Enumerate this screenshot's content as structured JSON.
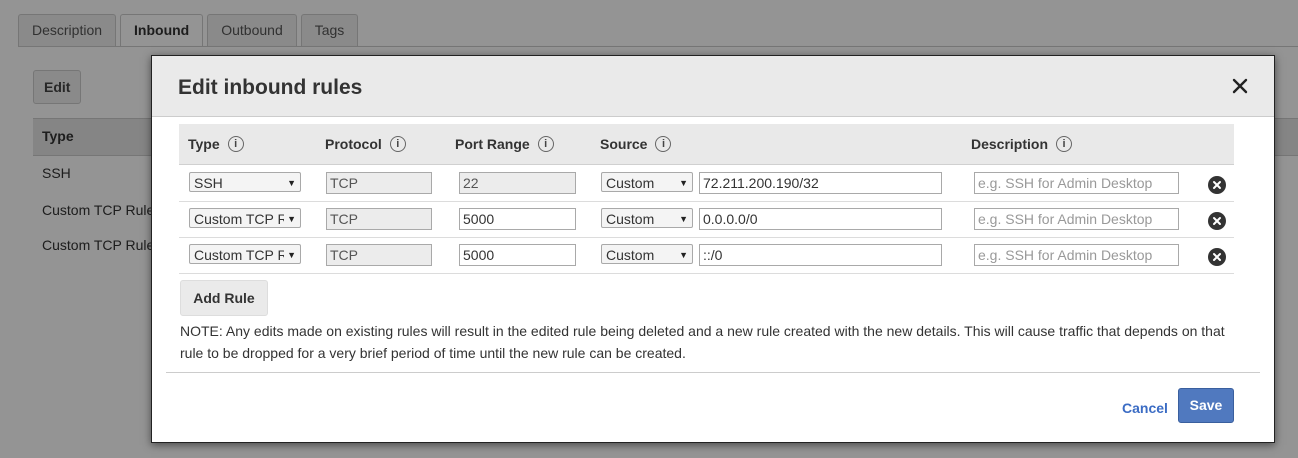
{
  "page_tabs": [
    {
      "label": "Description"
    },
    {
      "label": "Inbound"
    },
    {
      "label": "Outbound"
    },
    {
      "label": "Tags"
    }
  ],
  "bg": {
    "edit_label": "Edit",
    "type_header": "Type",
    "rows": [
      "SSH",
      "Custom TCP Rule",
      "Custom TCP Rule"
    ]
  },
  "modal": {
    "title": "Edit inbound rules",
    "columns": {
      "type": "Type",
      "protocol": "Protocol",
      "port_range": "Port Range",
      "source": "Source",
      "description": "Description"
    },
    "rules": [
      {
        "type": "SSH",
        "protocol": "TCP",
        "port": "22",
        "source_type": "Custom",
        "source": "72.211.200.190/32",
        "description_placeholder": "e.g. SSH for Admin Desktop"
      },
      {
        "type": "Custom TCP R",
        "protocol": "TCP",
        "port": "5000",
        "source_type": "Custom",
        "source": "0.0.0.0/0",
        "description_placeholder": "e.g. SSH for Admin Desktop"
      },
      {
        "type": "Custom TCP R",
        "protocol": "TCP",
        "port": "5000",
        "source_type": "Custom",
        "source": "::/0",
        "description_placeholder": "e.g. SSH for Admin Desktop"
      }
    ],
    "add_rule_label": "Add Rule",
    "note": "NOTE: Any edits made on existing rules will result in the edited rule being deleted and a new rule created with the new details. This will cause traffic that depends on that rule to be dropped for a very brief period of time until the new rule can be created.",
    "cancel_label": "Cancel",
    "save_label": "Save"
  },
  "icons": {
    "info": "info-circle-icon",
    "close": "close-icon",
    "delete": "remove-circle-icon",
    "dropdown": "caret-down-icon"
  },
  "colors": {
    "primary_button": "#5079bf",
    "link": "#3b6cc4",
    "overlay": "rgba(0,0,0,0.42)"
  }
}
